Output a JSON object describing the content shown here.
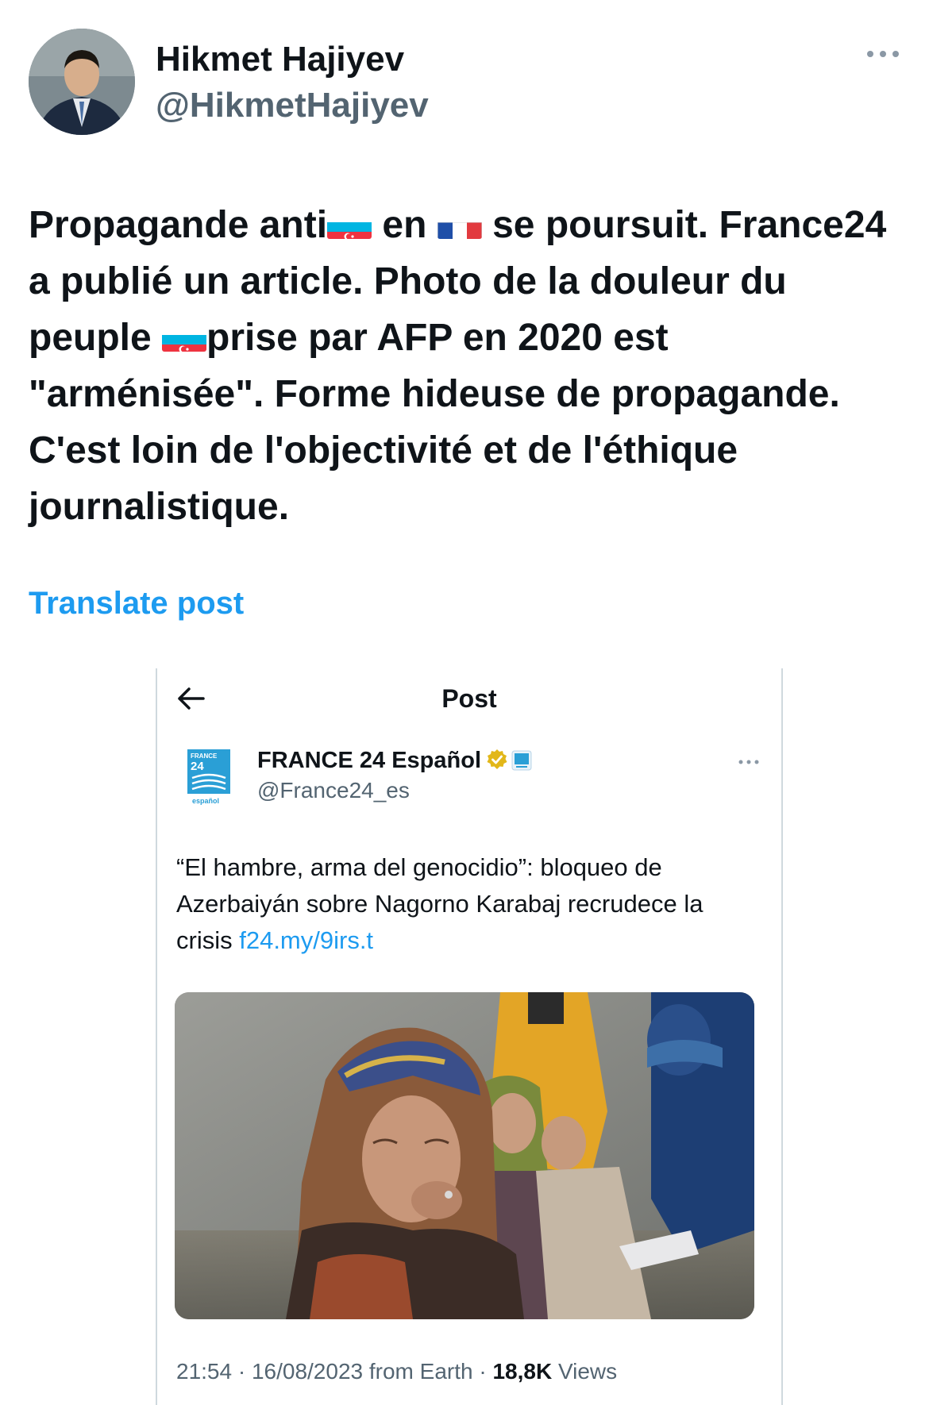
{
  "author": {
    "name": "Hikmet Hajiyev",
    "handle": "@HikmetHajiyev",
    "avatar_icon": "avatar-photo"
  },
  "post": {
    "segments": [
      "Propagande anti",
      " en ",
      " se poursuit. France24 a publié un article. Photo de la douleur du peuple ",
      "prise par AFP en 2020 est \"arménisée\". Forme hideuse de propagande. C'est loin de l'objectivité et de l'éthique journalistique."
    ],
    "flags": [
      "azerbaijan-flag",
      "france-flag",
      "azerbaijan-flag"
    ]
  },
  "translate_label": "Translate post",
  "embedded": {
    "screen_title": "Post",
    "back_icon": "arrow-left-icon",
    "account": {
      "name": "FRANCE 24 Español",
      "handle": "@France24_es",
      "logo_text_top": "FRANCE",
      "logo_text_num": "24",
      "logo_text_bottom": "español"
    },
    "text": "“El hambre, arma del genocidio”: bloqueo de Azerbaiyán sobre Nagorno Karabaj recrudece la crisis ",
    "link": "f24.my/9irs.t",
    "meta": {
      "prefix": "21:54 · 16/08/2023 from Earth · ",
      "views_count": "18,8K",
      "views_label": " Views"
    }
  },
  "colors": {
    "text": "#0f1419",
    "secondary": "#536471",
    "link": "#1d9bf0",
    "border": "#cfd9de"
  }
}
